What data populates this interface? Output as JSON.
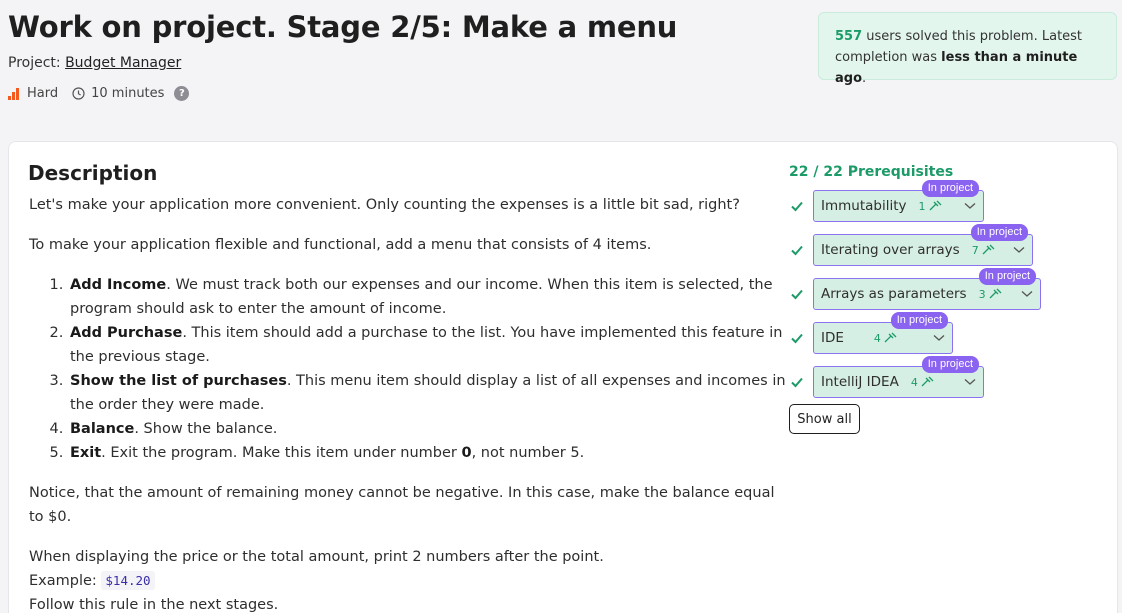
{
  "header": {
    "title": "Work on project. Stage 2/5: Make a menu",
    "project_prefix": "Project: ",
    "project_name": "Budget Manager",
    "difficulty": "Hard",
    "duration": "10 minutes",
    "help": "?"
  },
  "solved": {
    "count": "557",
    "text1": " users solved this problem. Latest completion was ",
    "recency": "less than a minute ago",
    "text2": "."
  },
  "description": {
    "title": "Description",
    "intro": "Let's make your application more convenient. Only counting the expenses is a little bit sad, right?",
    "para2": "To make your application flexible and functional, add a menu that consists of 4 items.",
    "items": [
      {
        "bold": "Add Income",
        "text": ". We must track both our expenses and our income. When this item is selected, the program should ask to enter the amount of income."
      },
      {
        "bold": "Add Purchase",
        "text": ". This item should add a purchase to the list. You have implemented this feature in the previous stage."
      },
      {
        "bold": "Show the list of purchases",
        "text": ". This menu item should display a list of all expenses and incomes in the order they were made."
      },
      {
        "bold": "Balance",
        "text": ". Show the balance."
      },
      {
        "bold": "Exit",
        "text_a": ". Exit the program. Make this item under number ",
        "num": "0",
        "text_b": ", not number 5."
      }
    ],
    "notice": "Notice, that the amount of remaining money cannot be negative. In this case, make the balance equal to $0.",
    "display_line": "When displaying the price or the total amount, print 2 numbers after the point.",
    "example_label": "Example: ",
    "example_code": "$14.20",
    "follow": "Follow this rule in the next stages."
  },
  "prerequisites": {
    "header": "22 / 22 Prerequisites",
    "badge_label": "In project",
    "items": [
      {
        "name": "Immutability",
        "level": "1"
      },
      {
        "name": "Iterating over arrays",
        "level": "7"
      },
      {
        "name": "Arrays as parameters",
        "level": "3"
      },
      {
        "name": "IDE",
        "level": "4"
      },
      {
        "name": "IntelliJ IDEA",
        "level": "4"
      }
    ],
    "show_all": "Show all"
  },
  "colors": {
    "accent_green": "#1c9b68",
    "badge_purple": "#8a63f0",
    "difficulty_orange": "#f25a22"
  }
}
